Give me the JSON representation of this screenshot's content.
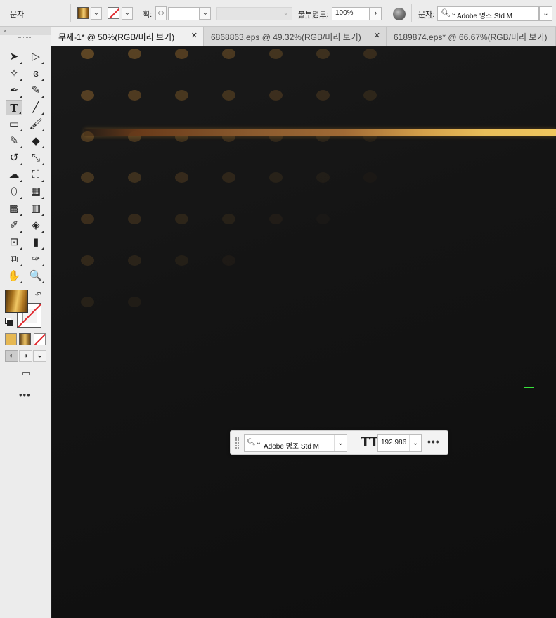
{
  "control_bar": {
    "tool_label": "문자",
    "stroke_weight_label": "획:",
    "stroke_weight_value": "",
    "opacity_label": "불투명도:",
    "opacity_value": "100%",
    "opacity_arrow": "›",
    "font_label": "문자:",
    "font_value": "Adobe 명조 Std M",
    "icons": [
      "fill-swatch",
      "stroke-none-swatch",
      "stepper",
      "globe-icon",
      "search-icon"
    ]
  },
  "tabs": [
    {
      "label": "무제-1* @ 50%(RGB/미리 보기)",
      "active": true,
      "close": "✕"
    },
    {
      "label": "6868863.eps @ 49.32%(RGB/미리 보기)",
      "active": false,
      "close": "✕"
    },
    {
      "label": "6189874.eps* @ 66.67%(RGB/미리 보기)",
      "active": false,
      "close": ""
    }
  ],
  "toolbox": {
    "collapse_label": "«",
    "more_label": "•••",
    "tools": [
      {
        "name": "selection-tool-icon",
        "glyph": "➤"
      },
      {
        "name": "direct-selection-tool-icon",
        "glyph": "▷"
      },
      {
        "name": "magic-wand-tool-icon",
        "glyph": "✧"
      },
      {
        "name": "lasso-tool-icon",
        "glyph": "ɞ"
      },
      {
        "name": "pen-tool-icon",
        "glyph": "✒"
      },
      {
        "name": "curvature-tool-icon",
        "glyph": "✎"
      },
      {
        "name": "type-tool-icon",
        "glyph": "T"
      },
      {
        "name": "line-segment-tool-icon",
        "glyph": "╱"
      },
      {
        "name": "rectangle-tool-icon",
        "glyph": "▭"
      },
      {
        "name": "paintbrush-tool-icon",
        "glyph": "🖌"
      },
      {
        "name": "shaper-tool-icon",
        "glyph": "✎"
      },
      {
        "name": "eraser-tool-icon",
        "glyph": "◆"
      },
      {
        "name": "rotate-tool-icon",
        "glyph": "↺"
      },
      {
        "name": "scale-tool-icon",
        "glyph": "⤡"
      },
      {
        "name": "warp-tool-icon",
        "glyph": "☁"
      },
      {
        "name": "free-transform-tool-icon",
        "glyph": "⛶"
      },
      {
        "name": "shape-builder-tool-icon",
        "glyph": "⬯"
      },
      {
        "name": "perspective-grid-tool-icon",
        "glyph": "▦"
      },
      {
        "name": "mesh-tool-icon",
        "glyph": "▩"
      },
      {
        "name": "gradient-tool-icon",
        "glyph": "▥"
      },
      {
        "name": "eyedropper-tool-icon",
        "glyph": "✐"
      },
      {
        "name": "blend-tool-icon",
        "glyph": "◈"
      },
      {
        "name": "symbol-sprayer-tool-icon",
        "glyph": "⊡"
      },
      {
        "name": "column-graph-tool-icon",
        "glyph": "▮"
      },
      {
        "name": "artboard-tool-icon",
        "glyph": "⧉"
      },
      {
        "name": "slice-tool-icon",
        "glyph": "✑"
      },
      {
        "name": "hand-tool-icon",
        "glyph": "✋"
      },
      {
        "name": "zoom-tool-icon",
        "glyph": "🔍"
      }
    ],
    "swap_glyph": "↶",
    "draw_modes": [
      "◐",
      "◑",
      "◒"
    ],
    "screen_mode_glyph": "▭"
  },
  "task_bar": {
    "font_value": "Adobe 명조 Std M",
    "size_icon": "TT",
    "size_value": "192.986",
    "more_label": "•••"
  },
  "colors": {
    "accent_gold": "#f0c65e",
    "canvas_bg": "#121212",
    "crosshair": "#37e23a"
  }
}
